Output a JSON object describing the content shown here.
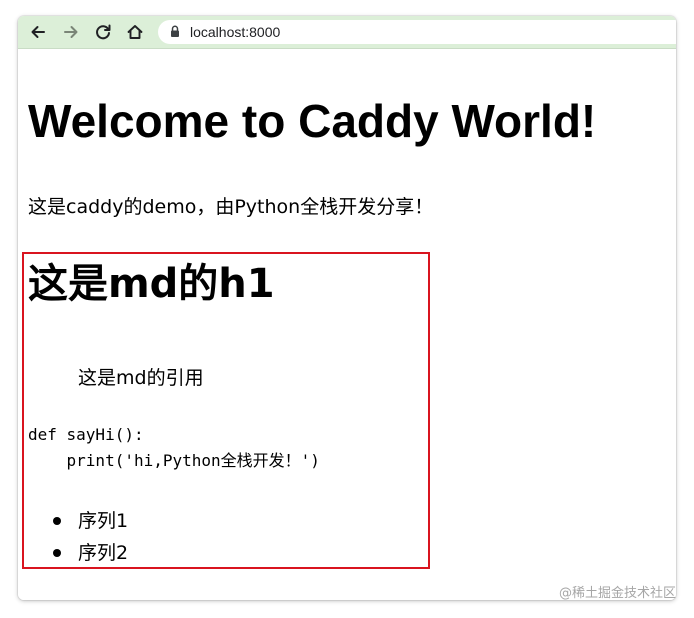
{
  "browser": {
    "back_icon": "arrow-left",
    "forward_icon": "arrow-right",
    "reload_icon": "reload",
    "home_icon": "home",
    "lock_icon": "lock",
    "url": "localhost:8000",
    "toolbar_color": "#dcefd8"
  },
  "page": {
    "title": "Welcome to Caddy World!",
    "intro": "这是caddy的demo，由Python全栈开发分享！"
  },
  "markdown": {
    "highlight_color": "#d9141f",
    "h1": "这是md的h1",
    "blockquote": "这是md的引用",
    "code_lines": [
      "def sayHi():",
      "    print('hi,Python全栈开发！')"
    ],
    "list_items": [
      "序列1",
      "序列2"
    ]
  },
  "watermark": "@稀土掘金技术社区"
}
